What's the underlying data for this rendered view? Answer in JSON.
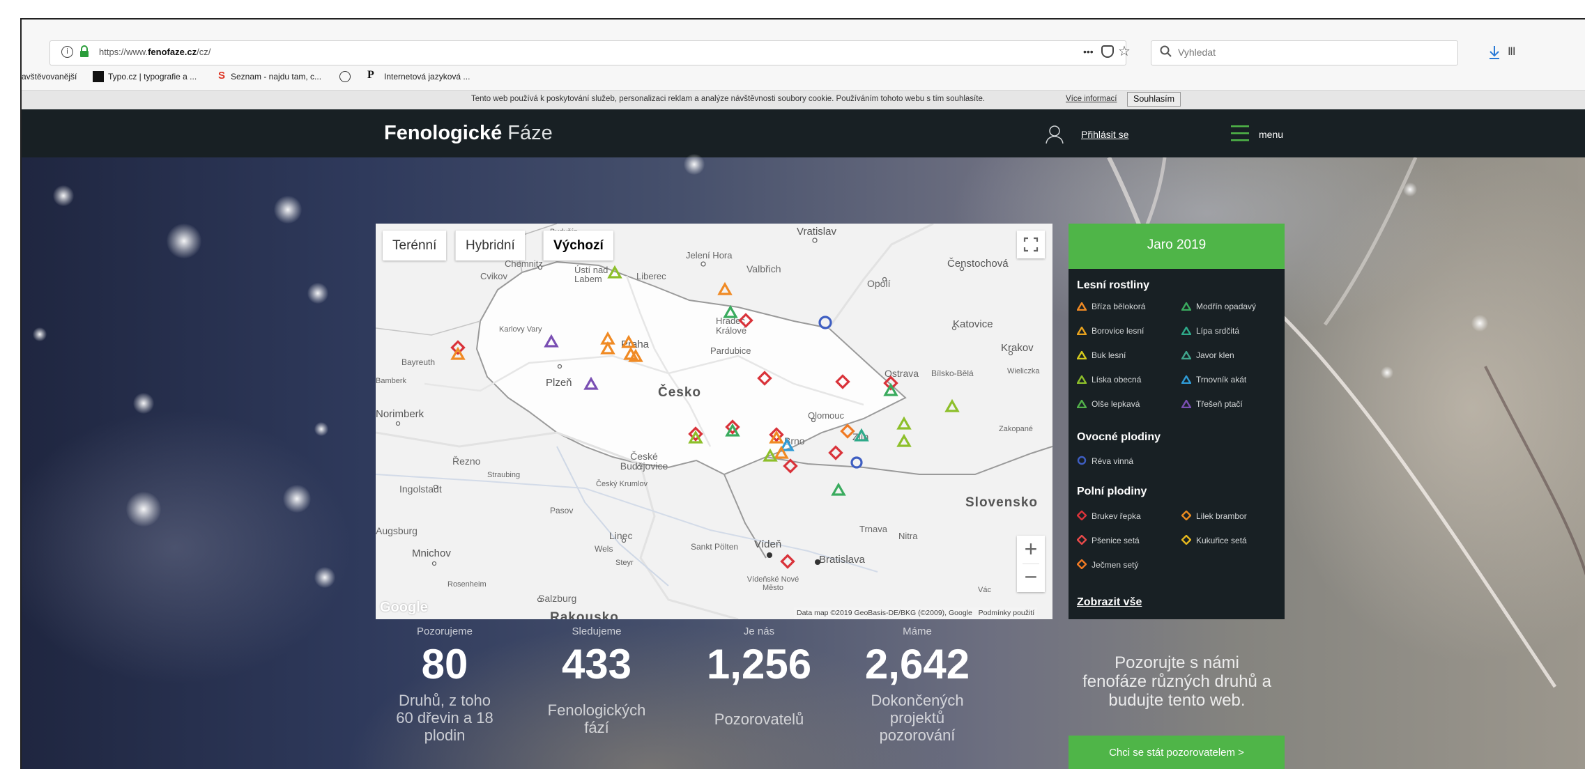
{
  "browser": {
    "url_prefix": "https://www.",
    "url_domain": "fenofaze.cz",
    "url_path": "/cz/",
    "search_placeholder": "Vyhledat",
    "dots": "•••"
  },
  "bookmarks": [
    {
      "label": "avštěvovanější"
    },
    {
      "label": "Typo.cz | typografie a ..."
    },
    {
      "label": "Seznam - najdu tam, c..."
    },
    {
      "label": "Internetová jazyková ..."
    }
  ],
  "cookie": {
    "text": "Tento web používá k poskytování služeb, personalizaci reklam a analýze návštěvnosti soubory cookie. Používáním tohoto webu s tím souhlasíte.",
    "more": "Více informací",
    "agree": "Souhlasím"
  },
  "nav": {
    "brand_bold": "Fenologické",
    "brand_light": "Fáze",
    "login": "Přihlásit se",
    "menu": "menu"
  },
  "map": {
    "btn_terrain": "Terénní",
    "btn_hybrid": "Hybridní",
    "btn_default": "Výchozí",
    "attribution": "Data map ©2019 GeoBasis-DE/BKG (©2009), Google",
    "terms": "Podmínky použití",
    "google": "Google",
    "zoom_in": "+",
    "zoom_out": "−",
    "labels": {
      "vratislav": "Vratislav",
      "jelenihora": "Jelení Hora",
      "valbrich": "Valbřich",
      "censtochova": "Čenstochová",
      "opoli": "Opolí",
      "katovice": "Katovice",
      "krakov": "Krakov",
      "ostrava": "Ostrava",
      "bielsko": "Bílsko-Bělá",
      "wieliczka": "Wieliczka",
      "zakopane": "Zakopané",
      "chemnitz": "Chemnitz",
      "cvikov": "Cvikov",
      "usti": "Ústí nad Labem",
      "liberec": "Liberec",
      "hradec": "Hradec Králové",
      "pardubice": "Pardubice",
      "karlovyvary": "Karlovy Vary",
      "praha": "Praha",
      "bayreuth": "Bayreuth",
      "bamberk": "Bamberk",
      "plzen": "Plzeň",
      "cesko": "Česko",
      "olomouc": "Olomouc",
      "norimberk": "Norimberk",
      "brno": "Brno",
      "zlin": "Zlín",
      "regensburg": "Řezno",
      "straubing": "Straubing",
      "ceskebudejovice": "České Budějovice",
      "ceskykrumlov": "Český Krumlov",
      "ingolstadt": "Ingolstadt",
      "slovensko": "Slovensko",
      "pasov": "Pasov",
      "augsburg": "Augsburg",
      "linec": "Linec",
      "wels": "Wels",
      "steyr": "Steyr",
      "stpolten": "Sankt Pölten",
      "viden": "Vídeň",
      "bratislava": "Bratislava",
      "trnava": "Trnava",
      "nitra": "Nitra",
      "mnichov": "Mnichov",
      "rosenheim": "Rosenheim",
      "salzburg": "Salzburg",
      "videnskenm": "Vídeňské Nové Město",
      "vac": "Vác",
      "budysin": "Budyšín",
      "rakousko": "Rakousko"
    }
  },
  "legend": {
    "title": "Jaro 2019",
    "sec_forest": "Lesní rostliny",
    "sec_fruit": "Ovocné plodiny",
    "sec_field": "Polní plodiny",
    "show_all": "Zobrazit vše",
    "forest": [
      "Bříza bělokorá",
      "Modřín opadavý",
      "Borovice lesní",
      "Lípa srdčitá",
      "Buk lesní",
      "Javor klen",
      "Líska obecná",
      "Trnovník akát",
      "Olše lepkavá",
      "Třešeň ptačí"
    ],
    "forest_colors": [
      "#f08a24",
      "#3aab5e",
      "#e8a21e",
      "#2eaa8a",
      "#d4c91d",
      "#40a58c",
      "#8dbf2a",
      "#2f9bd6",
      "#52b04a",
      "#7a4fb3"
    ],
    "fruit": [
      "Réva vinná"
    ],
    "fruit_colors": [
      "#3e5ec2"
    ],
    "field": [
      "Brukev řepka",
      "Lilek brambor",
      "Pšenice setá",
      "Kukuřice setá",
      "Ječmen setý"
    ],
    "field_colors": [
      "#d9333a",
      "#e88a20",
      "#e84a4a",
      "#e6b81e",
      "#f07a24"
    ]
  },
  "stats": [
    {
      "label": "Pozorujeme",
      "value": "80",
      "desc": "Druhů, z toho 60 dřevin a 18 plodin"
    },
    {
      "label": "Sledujeme",
      "value": "433",
      "desc": "Fenologických fází"
    },
    {
      "label": "Je nás",
      "value": "1,256",
      "desc": "Pozorovatelů"
    },
    {
      "label": "Máme",
      "value": "2,642",
      "desc": "Dokončených projektů pozorování"
    }
  ],
  "promo": {
    "text": "Pozorujte s námi fenofáze různých druhů a budujte tento web.",
    "cta": "Chci se stát pozorovatelem >"
  }
}
